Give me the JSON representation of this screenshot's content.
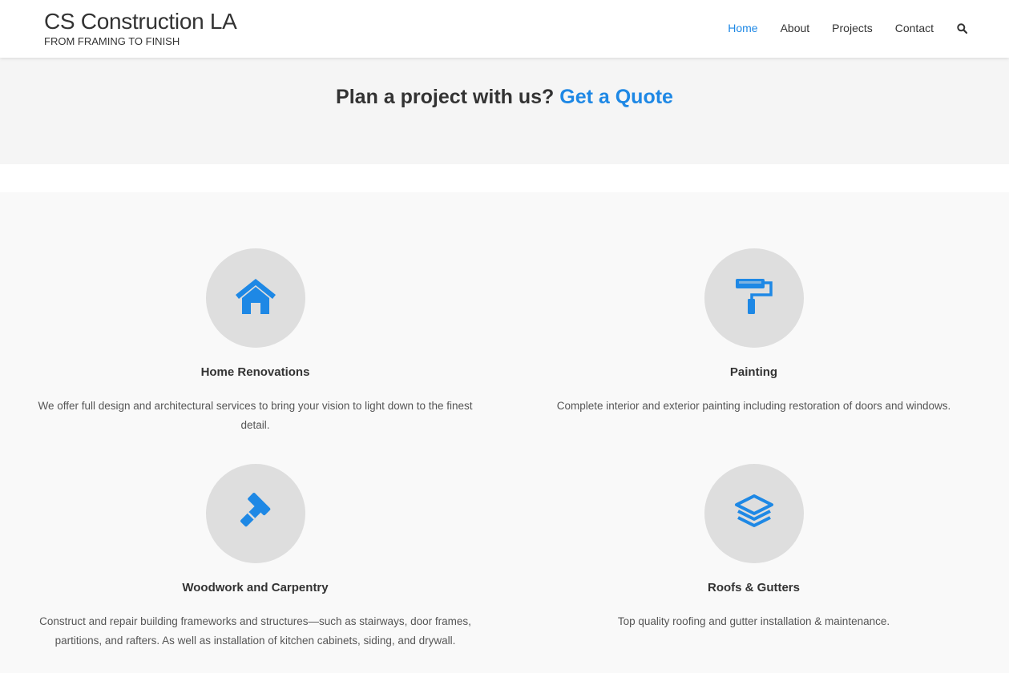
{
  "header": {
    "brand_title": "CS Construction LA",
    "brand_tagline": "FROM FRAMING TO FINISH",
    "nav": [
      {
        "label": "Home",
        "active": true
      },
      {
        "label": "About",
        "active": false
      },
      {
        "label": "Projects",
        "active": false
      },
      {
        "label": "Contact",
        "active": false
      }
    ],
    "search_icon": "search-icon"
  },
  "quote": {
    "text": "Plan a project with us?",
    "link": "Get a Quote"
  },
  "services": [
    {
      "icon": "house-icon",
      "title": "Home Renovations",
      "description": "We offer full design and architectural services to bring your vision to light down to the finest detail."
    },
    {
      "icon": "paint-roller-icon",
      "title": "Painting",
      "description": "Complete interior and exterior painting including restoration of doors and windows."
    },
    {
      "icon": "hammer-icon",
      "title": "Woodwork and Carpentry",
      "description": "Construct and repair building frameworks and structures—such as stairways, door frames, partitions, and rafters. As well as installation of kitchen cabinets, siding, and drywall."
    },
    {
      "icon": "layers-icon",
      "title": "Roofs & Gutters",
      "description": "Top quality roofing and gutter installation & maintenance."
    }
  ],
  "colors": {
    "accent": "#1e88e5",
    "text": "#333333",
    "icon_circle": "#dedede"
  }
}
